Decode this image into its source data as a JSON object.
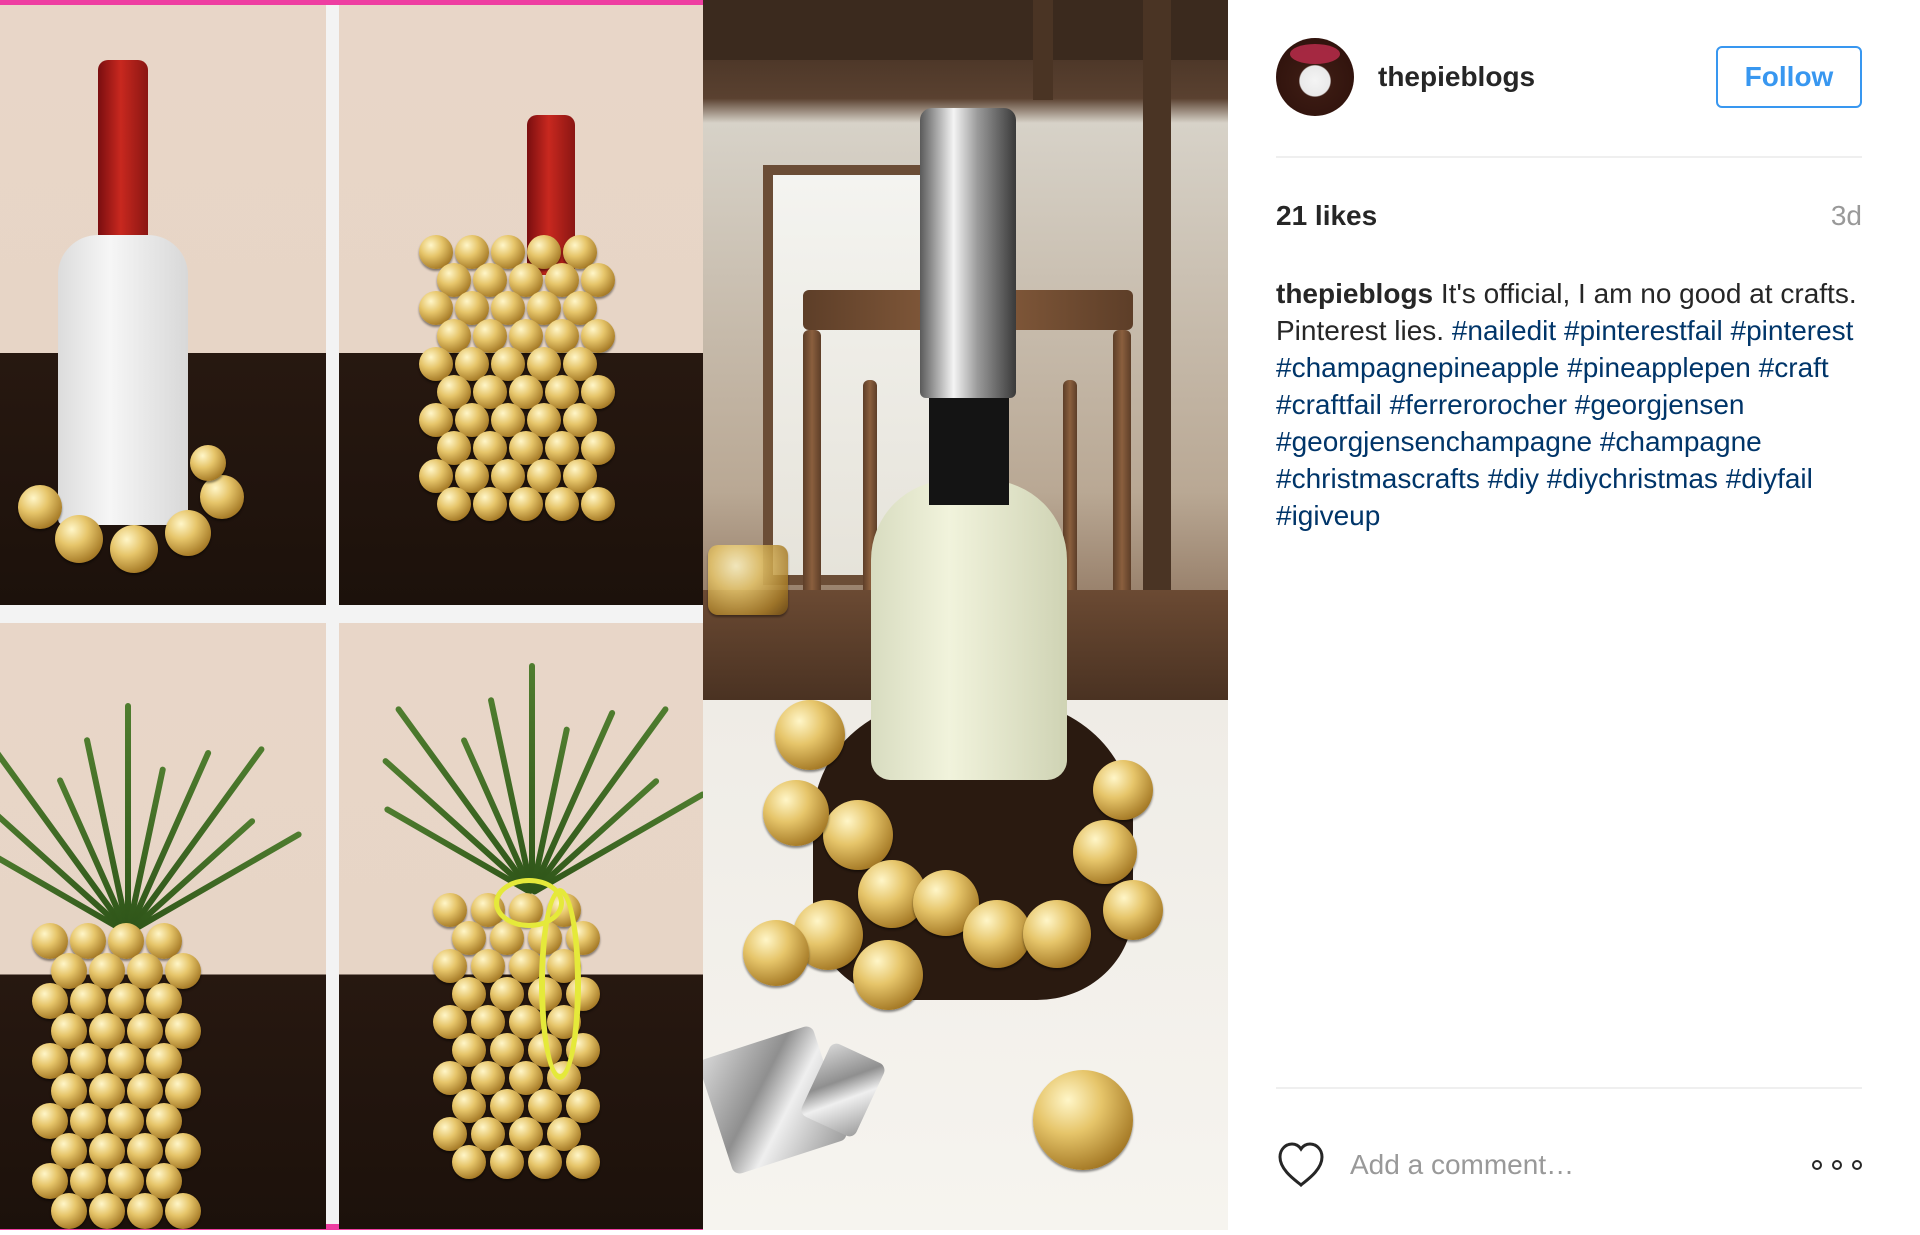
{
  "post": {
    "username": "thepieblogs",
    "follow_label": "Follow",
    "likes": "21 likes",
    "time": "3d",
    "caption_user": "thepieblogs",
    "caption_text": "It's official, I am no good at crafts. Pinterest lies.",
    "hashtags": [
      "#nailedit",
      "#pinterestfail",
      "#pinterest",
      "#champagnepineapple",
      "#pineapplepen",
      "#craft",
      "#craftfail",
      "#ferrerorocher",
      "#georgjensen",
      "#georgjensenchampagne",
      "#champagne",
      "#christmascrafts",
      "#diy",
      "#diychristmas",
      "#diyfail",
      "#igiveup"
    ],
    "comment_placeholder": "Add a comment…"
  },
  "icons": {
    "like": "heart-icon",
    "more": "more-options-icon"
  },
  "colors": {
    "accent": "#3897f0",
    "hashtag": "#003569",
    "muted": "#999999",
    "collage_border": "#ee3ea1"
  }
}
